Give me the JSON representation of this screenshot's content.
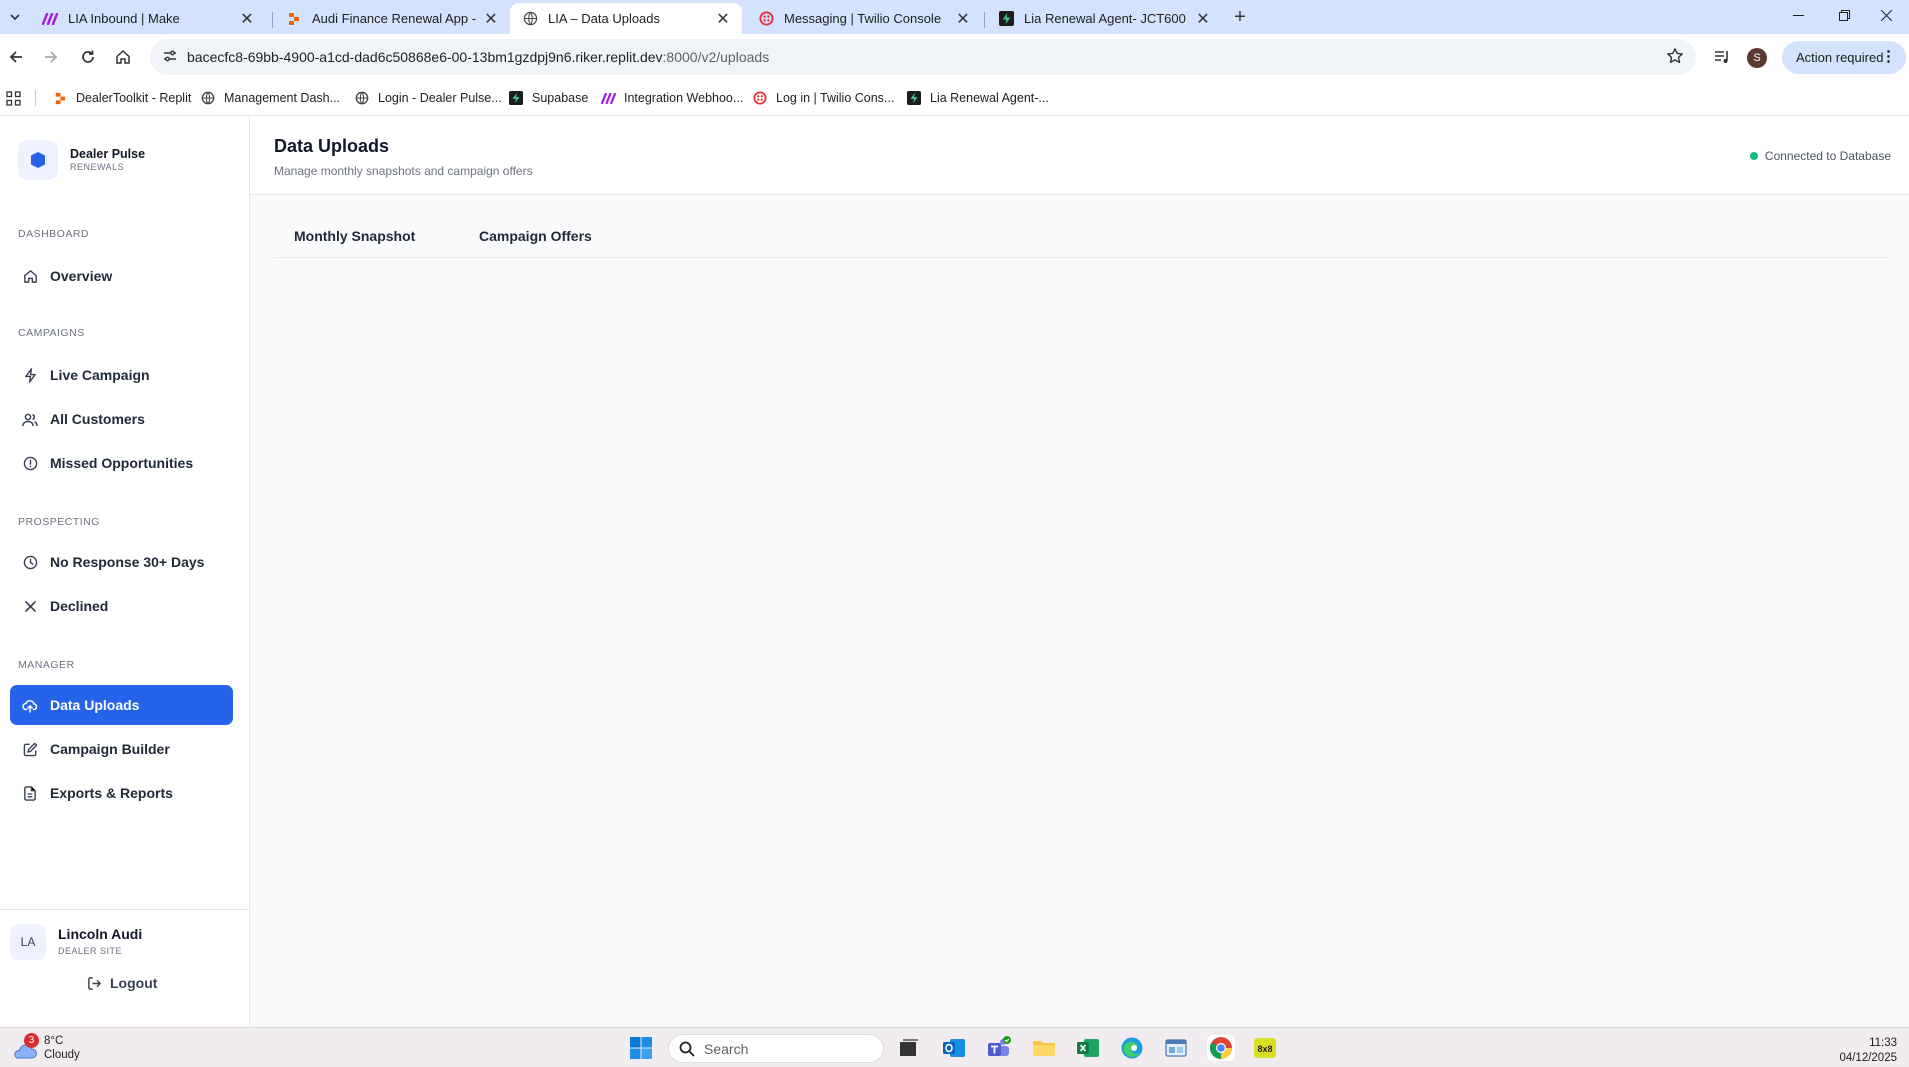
{
  "browser": {
    "tabs": [
      {
        "title": "LIA Inbound | Make",
        "icon": "make-icon",
        "active": false
      },
      {
        "title": "Audi Finance Renewal App - Re",
        "icon": "replit-icon",
        "active": false
      },
      {
        "title": "LIA – Data Uploads",
        "icon": "globe-icon",
        "active": true
      },
      {
        "title": "Messaging | Twilio Console",
        "icon": "twilio-icon",
        "active": false
      },
      {
        "title": "Lia Renewal Agent- JCT600 | Ch",
        "icon": "supabase-icon",
        "active": false
      }
    ],
    "url_host": "bacecfc8-69bb-4900-a1cd-dad6c50868e6-00-13bm1gzdpj9n6.riker.replit.dev",
    "url_path": ":8000/v2/uploads",
    "profile_initial": "S",
    "action_required": "Action required",
    "bookmarks": [
      {
        "label": "DealerToolkit - Replit",
        "icon": "replit-icon"
      },
      {
        "label": "Management Dash...",
        "icon": "globe-icon"
      },
      {
        "label": "Login - Dealer Pulse...",
        "icon": "globe-icon"
      },
      {
        "label": "Supabase",
        "icon": "supabase-icon"
      },
      {
        "label": "Integration Webhoo...",
        "icon": "make-icon"
      },
      {
        "label": "Log in | Twilio Cons...",
        "icon": "twilio-icon"
      },
      {
        "label": "Lia Renewal Agent-...",
        "icon": "supabase-icon"
      }
    ]
  },
  "sidebar": {
    "brand_name": "Dealer Pulse",
    "brand_sub": "RENEWALS",
    "sections": {
      "dashboard": "DASHBOARD",
      "campaigns": "CAMPAIGNS",
      "prospecting": "PROSPECTING",
      "manager": "MANAGER"
    },
    "items": {
      "overview": "Overview",
      "live_campaign": "Live Campaign",
      "all_customers": "All Customers",
      "missed_opportunities": "Missed Opportunities",
      "no_response": "No Response 30+ Days",
      "declined": "Declined",
      "data_uploads": "Data Uploads",
      "campaign_builder": "Campaign Builder",
      "exports_reports": "Exports & Reports"
    },
    "user": {
      "initials": "LA",
      "name": "Lincoln Audi",
      "role": "DEALER SITE"
    },
    "logout": "Logout"
  },
  "main": {
    "title": "Data Uploads",
    "subtitle": "Manage monthly snapshots and campaign offers",
    "db_status": "Connected to Database",
    "tabs": [
      "Monthly Snapshot",
      "Campaign Offers"
    ]
  },
  "taskbar": {
    "weather_temp": "8°C",
    "weather_desc": "Cloudy",
    "weather_badge": "3",
    "search_placeholder": "Search",
    "time": "11:33",
    "date": "04/12/2025"
  },
  "colors": {
    "accent": "#2563eb",
    "status_ok": "#10b981",
    "tabstrip": "#d3e3fd"
  }
}
